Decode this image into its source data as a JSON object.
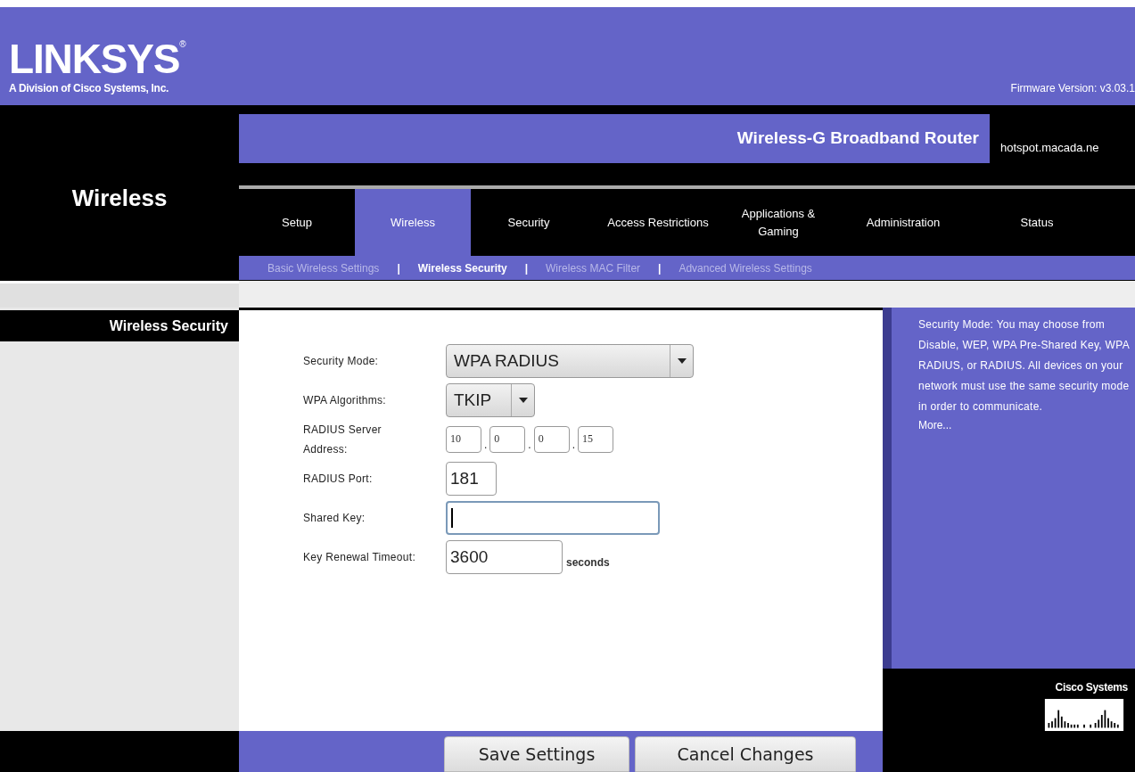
{
  "header": {
    "logo": "LINKSYS",
    "logo_mark": "®",
    "tagline": "A Division of Cisco Systems, Inc.",
    "firmware": "Firmware Version: v3.03.1"
  },
  "section_title": "Wireless",
  "product_name": "Wireless-G Broadband Router",
  "hostname": "hotspot.macada.ne",
  "tabs": [
    {
      "label": "Setup",
      "selected": false
    },
    {
      "label": "Wireless",
      "selected": true
    },
    {
      "label": "Security",
      "selected": false
    },
    {
      "label": "Access Restrictions",
      "selected": false
    },
    {
      "label": "Applications & Gaming",
      "selected": false
    },
    {
      "label": "Administration",
      "selected": false
    },
    {
      "label": "Status",
      "selected": false
    }
  ],
  "subtab_separator": "|",
  "subtabs": [
    {
      "label": "Basic Wireless Settings",
      "selected": false
    },
    {
      "label": "Wireless Security",
      "selected": true
    },
    {
      "label": "Wireless MAC Filter",
      "selected": false
    },
    {
      "label": "Advanced Wireless Settings",
      "selected": false
    }
  ],
  "sidebar": {
    "heading": "Wireless Security"
  },
  "form": {
    "fields": [
      {
        "kind": "select",
        "label": "Security Mode:",
        "value": "WPA RADIUS"
      },
      {
        "kind": "select",
        "label": "WPA Algorithms:",
        "value": "TKIP"
      },
      {
        "kind": "ip",
        "label": "RADIUS Server Address:",
        "octets": [
          "10",
          "0",
          "0",
          "15"
        ],
        "separator": "."
      },
      {
        "kind": "text",
        "label": "RADIUS Port:",
        "value": "181",
        "focused": false
      },
      {
        "kind": "text",
        "label": "Shared Key:",
        "focused": true
      },
      {
        "kind": "text",
        "label": "Key Renewal Timeout:",
        "value": "3600",
        "focused": false,
        "unit": "seconds"
      }
    ]
  },
  "help": {
    "text": "Security Mode: You may choose from Disable, WEP, WPA Pre-Shared Key, WPA RADIUS, or RADIUS. All devices on your network must use the same security mode in order to communicate.",
    "link": "More..."
  },
  "brand": "Cisco Systems",
  "buttons": [
    "Save Settings",
    "Cancel Changes"
  ]
}
